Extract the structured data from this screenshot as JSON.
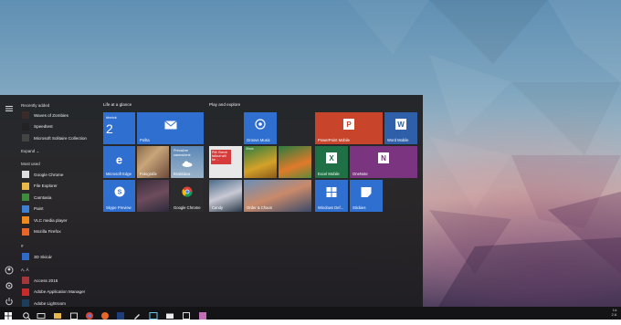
{
  "colors": {
    "accent": "#2d6bc9",
    "tile_blue": "#2f6fd0",
    "tile_orange": "#c8452c",
    "tile_green": "#2a7d3f",
    "tile_purple": "#7b3580",
    "tile_excel": "#1f7145",
    "start_bg": "#1c1c1e",
    "taskbar_bg": "#141416"
  },
  "applist": {
    "recently_added_label": "Recently added",
    "recent": [
      {
        "label": "Waves of Zombies",
        "icon": "zombie-icon",
        "color": "#3a2a2a"
      },
      {
        "label": "Speedtest",
        "icon": "speedtest-icon",
        "color": "#222"
      },
      {
        "label": "Microsoft Solitaire Collection",
        "icon": "cards-icon",
        "color": "#444"
      }
    ],
    "expand_label": "Expand",
    "most_used_label": "Most used",
    "most_used": [
      {
        "label": "Google Chrome",
        "icon": "chrome-icon",
        "color": "#ddd"
      },
      {
        "label": "File Explorer",
        "icon": "folder-icon",
        "color": "#e8b84a"
      },
      {
        "label": "Camtasia",
        "icon": "camtasia-icon",
        "color": "#3c8c3c"
      },
      {
        "label": "Paint",
        "icon": "paint-icon",
        "color": "#3f7fcf"
      },
      {
        "label": "VLC media player",
        "icon": "vlc-icon",
        "color": "#f08a1c"
      },
      {
        "label": "Mozilla Firefox",
        "icon": "firefox-icon",
        "color": "#e8662a"
      }
    ],
    "letter_hash": "#",
    "hash_items": [
      {
        "label": "3D Skicár",
        "icon": "paint3d-icon",
        "color": "#2d6bc9"
      }
    ],
    "letter_a": "A, Á",
    "a_items": [
      {
        "label": "Access 2016",
        "icon": "access-icon",
        "color": "#a4373a"
      },
      {
        "label": "Adobe Application Manager",
        "icon": "adobe-icon",
        "color": "#c62b2b"
      },
      {
        "label": "Adobe Lightroom",
        "icon": "lightroom-icon",
        "color": "#1d3d5c"
      }
    ]
  },
  "groups": {
    "life": "Life at a glance",
    "play": "Play and explore"
  },
  "tiles": {
    "calendar_day": "štvrtok",
    "calendar_date": "2",
    "mail": "Pošta",
    "weather_line1": "Prevažne zamračené",
    "weather_line2": "Bratislava",
    "edge": "Microsoft Edge",
    "photos": "Fotografie",
    "skype": "Skype Preview",
    "chrome": "Google Chrome",
    "groove": "Groove Music",
    "xbox": "Xbox",
    "news": "PM: Brexit fallout will be ...",
    "paint_placeholder": "",
    "powerpoint": "PowerPoint Mobile",
    "word": "Word Mobile",
    "excel": "Excel Mobile",
    "onenote": "OneNote",
    "windows_defender": "Windows Def...",
    "stickies": "Stickies",
    "game1": "Candy",
    "game2": "Order & Chaos"
  },
  "rail": {
    "hamburger": "menu-icon",
    "user": "user-icon",
    "settings": "gear-icon",
    "power": "power-icon"
  },
  "taskbar": {
    "time": "14:",
    "date": "2.6."
  }
}
